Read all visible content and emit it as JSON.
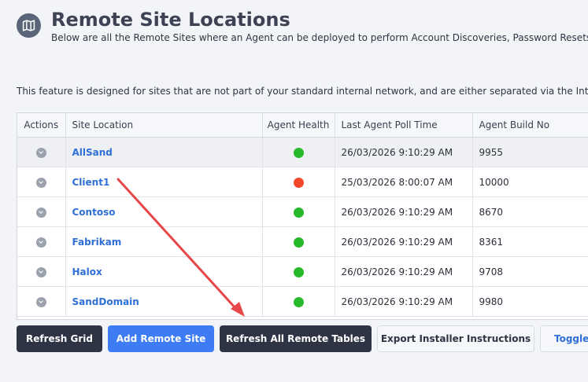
{
  "header": {
    "title": "Remote Site Locations",
    "subtitle": "Below are all the Remote Sites where an Agent can be deployed to perform Account Discoveries, Password Resets, a",
    "icon": "map-icon"
  },
  "feature_note": "This feature is designed for sites that are not part of your standard internal network, and are either separated via the Internet,",
  "grid": {
    "columns": [
      "Actions",
      "Site Location",
      "Agent Health",
      "Last Agent Poll Time",
      "Agent Build No"
    ],
    "rows": [
      {
        "site": "AllSand",
        "health": "green",
        "poll": "26/03/2026 9:10:29 AM",
        "build": "9955"
      },
      {
        "site": "Client1",
        "health": "red",
        "poll": "25/03/2026 8:00:07 AM",
        "build": "10000"
      },
      {
        "site": "Contoso",
        "health": "green",
        "poll": "26/03/2026 9:10:29 AM",
        "build": "8670"
      },
      {
        "site": "Fabrikam",
        "health": "green",
        "poll": "26/03/2026 9:10:29 AM",
        "build": "8361"
      },
      {
        "site": "Halox",
        "health": "green",
        "poll": "26/03/2026 9:10:29 AM",
        "build": "9708"
      },
      {
        "site": "SandDomain",
        "health": "green",
        "poll": "26/03/2026 9:10:29 AM",
        "build": "9980"
      }
    ]
  },
  "buttons": {
    "refresh_grid": "Refresh Grid",
    "add_remote_site": "Add Remote Site",
    "refresh_all": "Refresh All Remote Tables",
    "export_instructions": "Export Installer Instructions",
    "toggle": "Toggle"
  },
  "colors": {
    "health_green": "#27b82b",
    "health_red": "#f2472c",
    "annotation_arrow": "#e8474a"
  }
}
